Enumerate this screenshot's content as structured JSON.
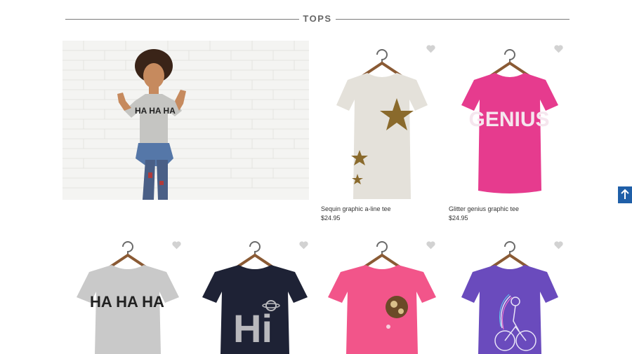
{
  "section": {
    "title": "TOPS"
  },
  "hero": {
    "shirt_text": "HA HA HA"
  },
  "products": [
    {
      "name": "Sequin graphic a-line tee",
      "price": "$24.95",
      "shirt_color": "#e4e1da",
      "graphic": "sequin-star"
    },
    {
      "name": "Glitter genius graphic tee",
      "price": "$24.95",
      "shirt_color": "#e63b8e",
      "graphic_text": "GENIUS"
    },
    {
      "name": "",
      "price": "",
      "shirt_color": "#c9c9c9",
      "graphic_text": "HA HA HA"
    },
    {
      "name": "",
      "price": "",
      "shirt_color": "#1e2235",
      "graphic_text": "Hi"
    },
    {
      "name": "",
      "price": "",
      "shirt_color": "#f2558a",
      "graphic": "sequin-circle"
    },
    {
      "name": "",
      "price": "",
      "shirt_color": "#6a4bbd",
      "graphic": "bicycle-girl"
    }
  ],
  "colors": {
    "favorite_icon": "#d2d2d2",
    "back_to_top": "#1f5fa8"
  },
  "icons": {
    "favorite": "heart-icon",
    "back_to_top": "arrow-up-icon"
  }
}
